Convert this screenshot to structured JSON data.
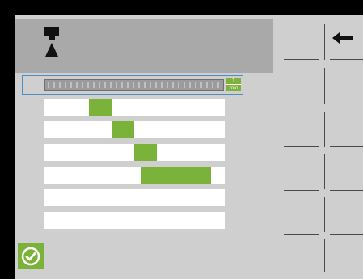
{
  "header": {
    "tool_icon": "tool-holder-icon",
    "back_icon": "arrow-left-icon"
  },
  "feed": {
    "unit_numerator": "1",
    "unit_denominator": "min",
    "unit_icon": "feed-per-minute-icon"
  },
  "sequence": {
    "rows": [
      {
        "block_start": 0.25,
        "block_end": 0.375
      },
      {
        "block_start": 0.375,
        "block_end": 0.5
      },
      {
        "block_start": 0.5,
        "block_end": 0.625
      },
      {
        "block_start": 0.535,
        "block_end": 0.925
      },
      {
        "block_start": null,
        "block_end": null
      },
      {
        "block_start": null,
        "block_end": null
      }
    ]
  },
  "footer": {
    "confirm_icon": "checkmark-circle-icon"
  },
  "colors": {
    "background": "#cfcfd0",
    "header": "#a9a9aa",
    "accent_green": "#7ab23a",
    "selection_border": "#4a8fc8"
  }
}
